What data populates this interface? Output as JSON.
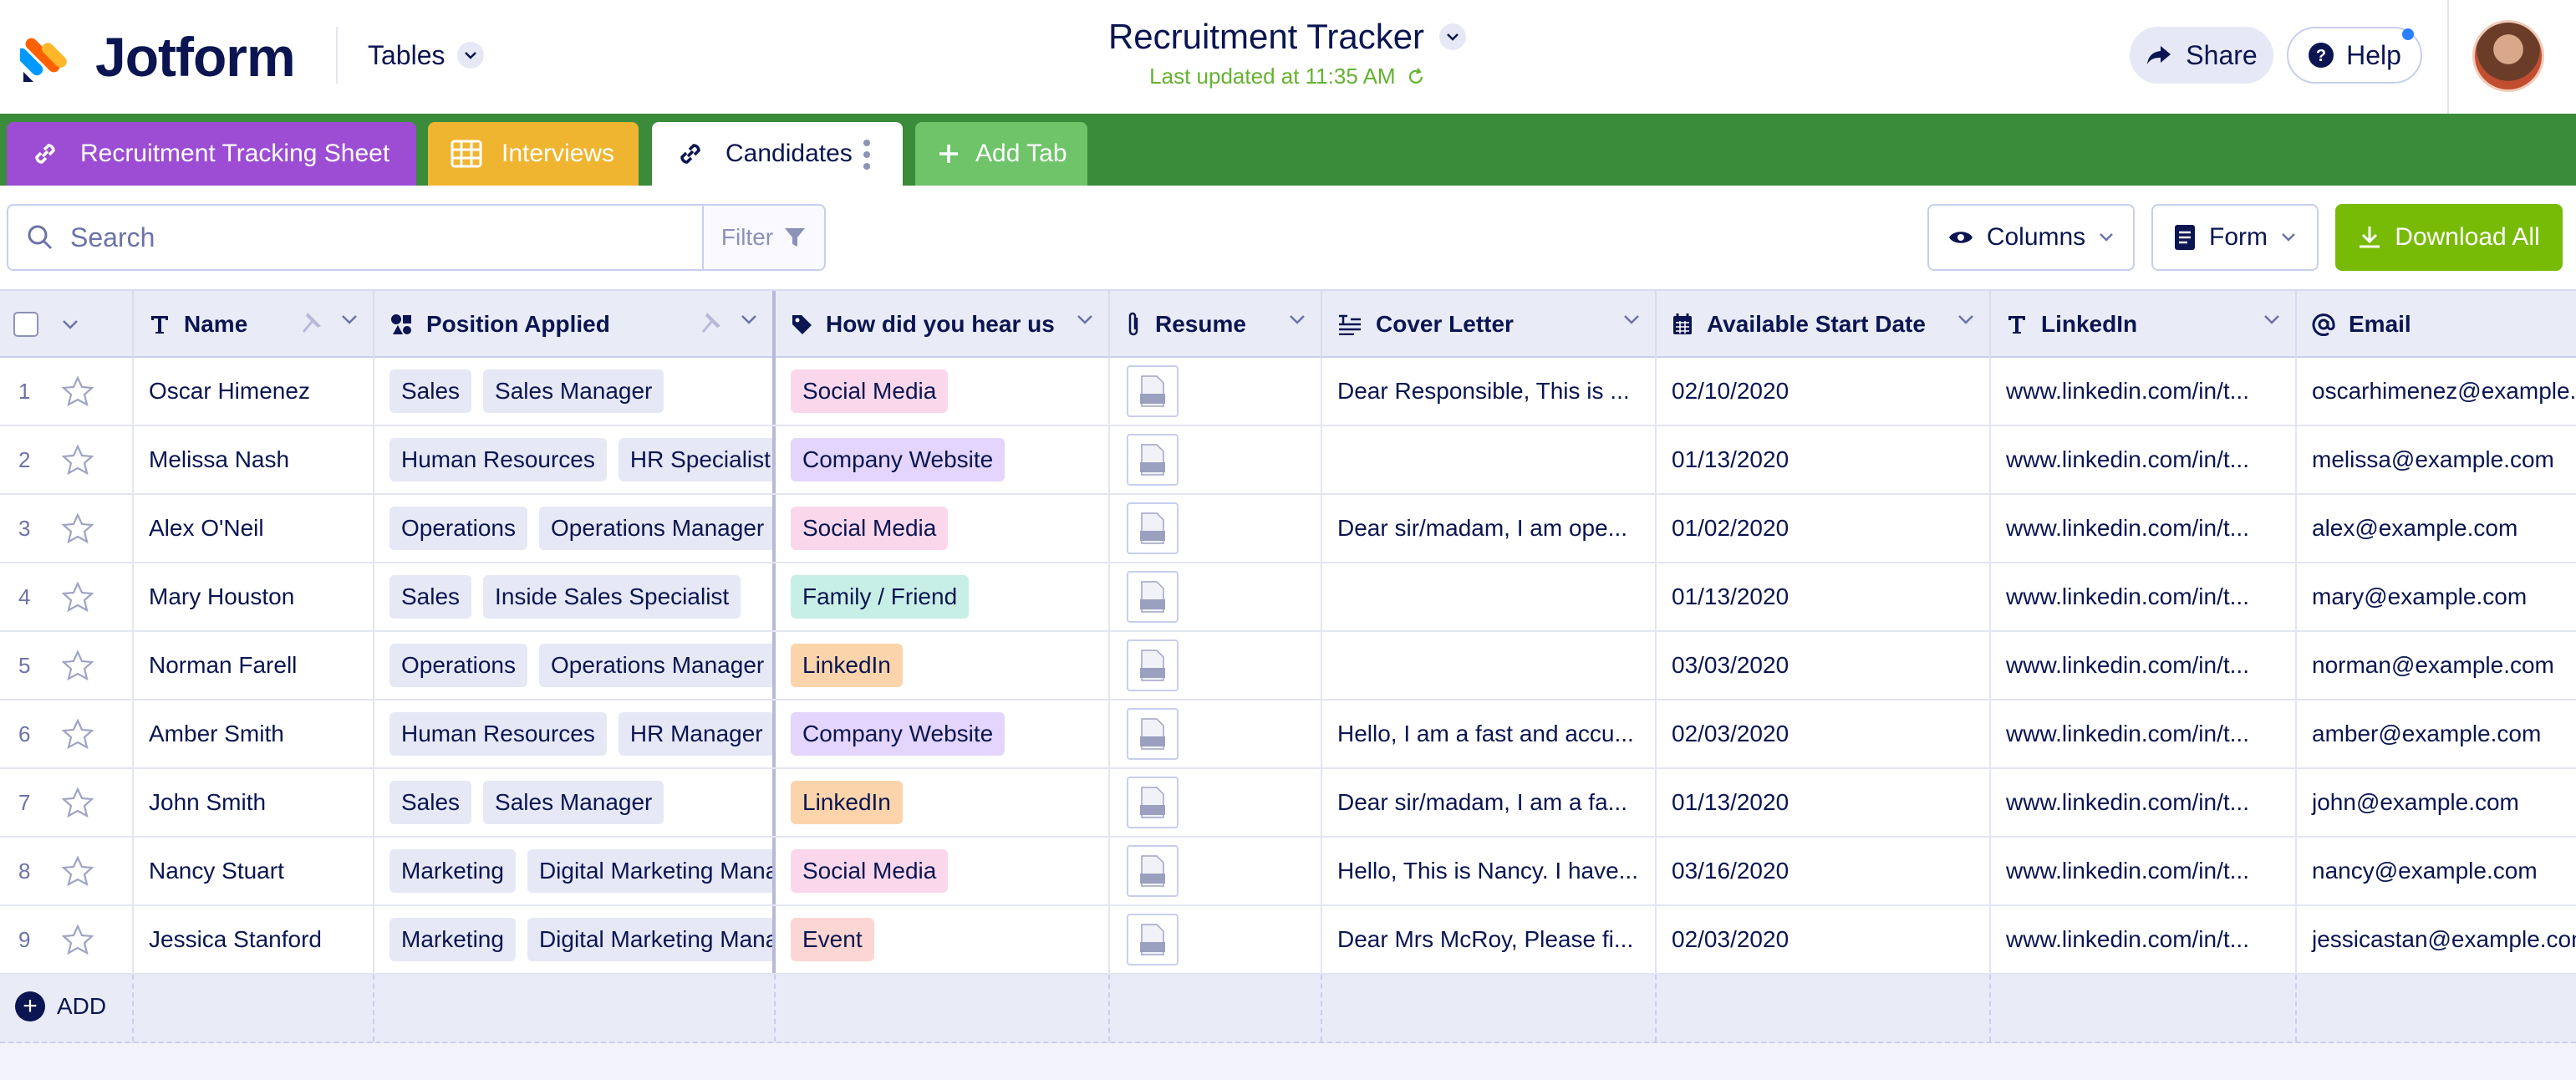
{
  "app": {
    "brand": "Jotform",
    "tables_menu": "Tables",
    "title": "Recruitment Tracker",
    "last_updated": "Last updated at 11:35 AM",
    "share_label": "Share",
    "help_label": "Help"
  },
  "tabs": [
    {
      "label": "Recruitment Tracking Sheet",
      "icon": "link-icon",
      "color": "#9c4dd3"
    },
    {
      "label": "Interviews",
      "icon": "grid-icon",
      "color": "#f0b530"
    },
    {
      "label": "Candidates",
      "icon": "link-icon",
      "color": "#ffffff",
      "active": true
    },
    {
      "label": "Add Tab",
      "icon": "plus-icon",
      "color": "#6fc46a"
    }
  ],
  "toolbar": {
    "search_placeholder": "Search",
    "filter_label": "Filter",
    "columns_label": "Columns",
    "form_label": "Form",
    "download_label": "Download All"
  },
  "columns": [
    {
      "label": "Name",
      "icon": "text-icon"
    },
    {
      "label": "Position Applied",
      "icon": "shapes-icon"
    },
    {
      "label": "How did you hear us",
      "icon": "tag-icon"
    },
    {
      "label": "Resume",
      "icon": "paperclip-icon"
    },
    {
      "label": "Cover Letter",
      "icon": "paragraph-icon"
    },
    {
      "label": "Available Start Date",
      "icon": "calendar-icon"
    },
    {
      "label": "LinkedIn",
      "icon": "text-icon"
    },
    {
      "label": "Email",
      "icon": "at-icon"
    }
  ],
  "rows": [
    {
      "num": "1",
      "name": "Oscar Himenez",
      "dept": "Sales",
      "position": "Sales Manager",
      "source": "Social Media",
      "source_color": "#fbd7ec",
      "cover": "Dear Responsible, This is ...",
      "date": "02/10/2020",
      "linkedin": "www.linkedin.com/in/t...",
      "email": "oscarhimenez@example.com"
    },
    {
      "num": "2",
      "name": "Melissa Nash",
      "dept": "Human Resources",
      "position": "HR Specialist",
      "source": "Company Website",
      "source_color": "#e3d5fb",
      "cover": "",
      "date": "01/13/2020",
      "linkedin": "www.linkedin.com/in/t...",
      "email": "melissa@example.com"
    },
    {
      "num": "3",
      "name": "Alex O'Neil",
      "dept": "Operations",
      "position": "Operations Manager",
      "source": "Social Media",
      "source_color": "#fbd7ec",
      "cover": "Dear sir/madam, I am ope...",
      "date": "01/02/2020",
      "linkedin": "www.linkedin.com/in/t...",
      "email": "alex@example.com"
    },
    {
      "num": "4",
      "name": "Mary Houston",
      "dept": "Sales",
      "position": "Inside Sales Specialist",
      "source": "Family / Friend",
      "source_color": "#c8efe6",
      "cover": "",
      "date": "01/13/2020",
      "linkedin": "www.linkedin.com/in/t...",
      "email": "mary@example.com"
    },
    {
      "num": "5",
      "name": "Norman Farell",
      "dept": "Operations",
      "position": "Operations Manager",
      "source": "LinkedIn",
      "source_color": "#fbd4ab",
      "cover": "",
      "date": "03/03/2020",
      "linkedin": "www.linkedin.com/in/t...",
      "email": "norman@example.com"
    },
    {
      "num": "6",
      "name": "Amber Smith",
      "dept": "Human Resources",
      "position": "HR Manager",
      "source": "Company Website",
      "source_color": "#e3d5fb",
      "cover": "Hello, I am a fast and accu...",
      "date": "02/03/2020",
      "linkedin": "www.linkedin.com/in/t...",
      "email": "amber@example.com"
    },
    {
      "num": "7",
      "name": "John Smith",
      "dept": "Sales",
      "position": "Sales Manager",
      "source": "LinkedIn",
      "source_color": "#fbd4ab",
      "cover": "Dear sir/madam, I am a fa...",
      "date": "01/13/2020",
      "linkedin": "www.linkedin.com/in/t...",
      "email": "john@example.com"
    },
    {
      "num": "8",
      "name": "Nancy Stuart",
      "dept": "Marketing",
      "position": "Digital Marketing Manager",
      "source": "Social Media",
      "source_color": "#fbd7ec",
      "cover": "Hello, This is Nancy. I have...",
      "date": "03/16/2020",
      "linkedin": "www.linkedin.com/in/t...",
      "email": "nancy@example.com"
    },
    {
      "num": "9",
      "name": "Jessica Stanford",
      "dept": "Marketing",
      "position": "Digital Marketing Manager",
      "source": "Event",
      "source_color": "#fcd6d3",
      "cover": "Dear Mrs McRoy, Please fi...",
      "date": "02/03/2020",
      "linkedin": "www.linkedin.com/in/t...",
      "email": "jessicastan@example.com"
    }
  ],
  "resume_badge": "PDF",
  "add_row_label": "ADD"
}
